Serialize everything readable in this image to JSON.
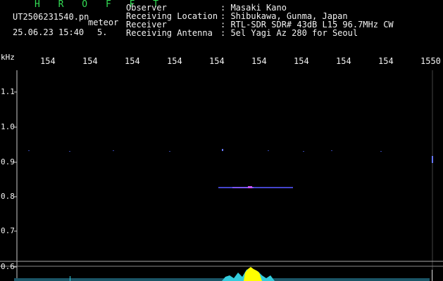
{
  "header": {
    "station": "H R O F F T",
    "filename": "UT2506231540.pn",
    "event": "meteor",
    "datetime": "25.06.23 15:40",
    "count": "5."
  },
  "info": [
    {
      "label": "Observer",
      "value": ": Masaki Kano"
    },
    {
      "label": "Receiving Location",
      "value": ": Shibukawa, Gunma, Japan"
    },
    {
      "label": "Receiver",
      "value": ": RTL-SDR SDR# 43dB L15 96.7MHz CW"
    },
    {
      "label": "Receiving Antenna",
      "value": ": 5el Yagi Az 280 for Seoul"
    }
  ],
  "axis": {
    "y_unit": "kHz",
    "x_ticks": [
      "154",
      "154",
      "154",
      "154",
      "154",
      "154",
      "154",
      "154",
      "154",
      "1550"
    ],
    "y_ticks": [
      "1.1",
      "1.0",
      "0.9",
      "0.8",
      "0.7",
      "0.6"
    ]
  },
  "colors": {
    "background": "#000000",
    "text": "#f2f2f2",
    "station": "#33dd55",
    "echo": "#5555ff",
    "spectrum": "#33ccdd",
    "peak": "#ffff00"
  }
}
